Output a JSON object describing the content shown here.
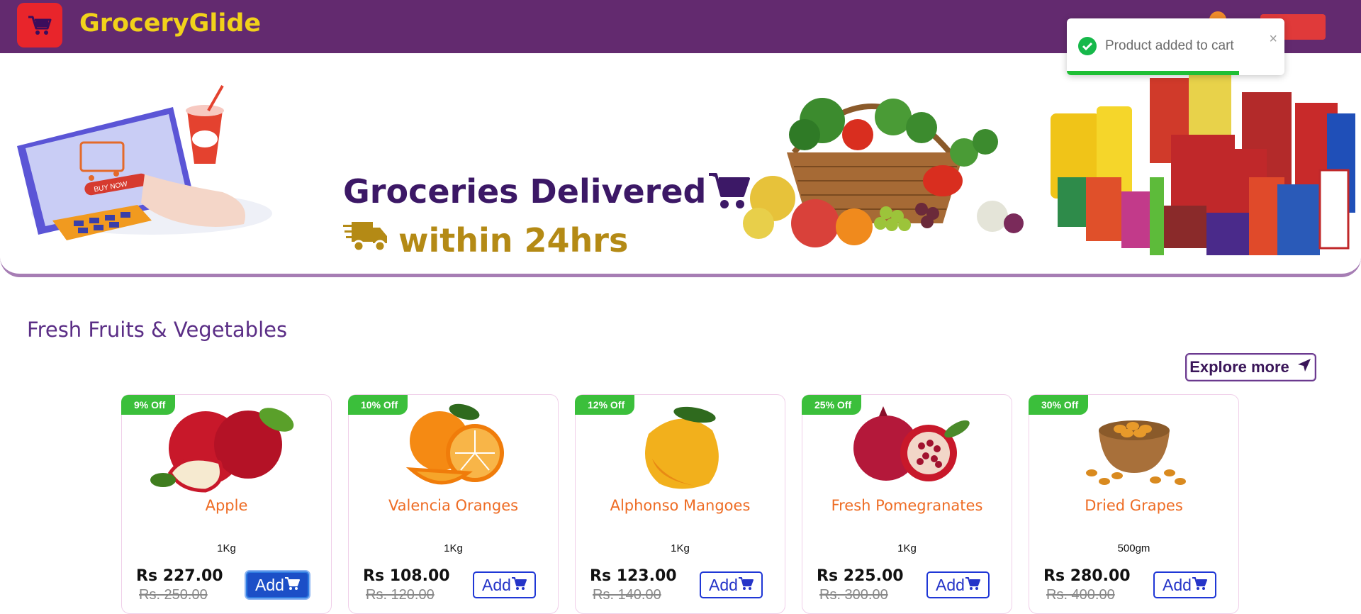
{
  "header": {
    "brand": "GroceryGlide"
  },
  "toast": {
    "message": "Product added to cart",
    "close": "×",
    "progress": 0.79
  },
  "banner": {
    "line1": "Groceries Delivered",
    "line2": "within 24hrs",
    "laptop_button_text": "BUY NOW"
  },
  "section": {
    "title": "Fresh Fruits & Vegetables",
    "explore_label": "Explore more"
  },
  "products": [
    {
      "discount": "9% Off",
      "name": "Apple",
      "qty": "1Kg",
      "price": "Rs 227.00",
      "mrp": "Rs. 250.00",
      "add": "Add",
      "image": "apple",
      "active": true
    },
    {
      "discount": "10% Off",
      "name": "Valencia Oranges",
      "qty": "1Kg",
      "price": "Rs 108.00",
      "mrp": "Rs. 120.00",
      "add": "Add",
      "image": "orange",
      "active": false
    },
    {
      "discount": "12% Off",
      "name": "Alphonso Mangoes",
      "qty": "1Kg",
      "price": "Rs 123.00",
      "mrp": "Rs. 140.00",
      "add": "Add",
      "image": "mango",
      "active": false
    },
    {
      "discount": "25% Off",
      "name": "Fresh Pomegranates",
      "qty": "1Kg",
      "price": "Rs 225.00",
      "mrp": "Rs. 300.00",
      "add": "Add",
      "image": "pomegranate",
      "active": false
    },
    {
      "discount": "30% Off",
      "name": "Dried Grapes",
      "qty": "500gm",
      "price": "Rs 280.00",
      "mrp": "Rs. 400.00",
      "add": "Add",
      "image": "raisins",
      "active": false
    }
  ]
}
